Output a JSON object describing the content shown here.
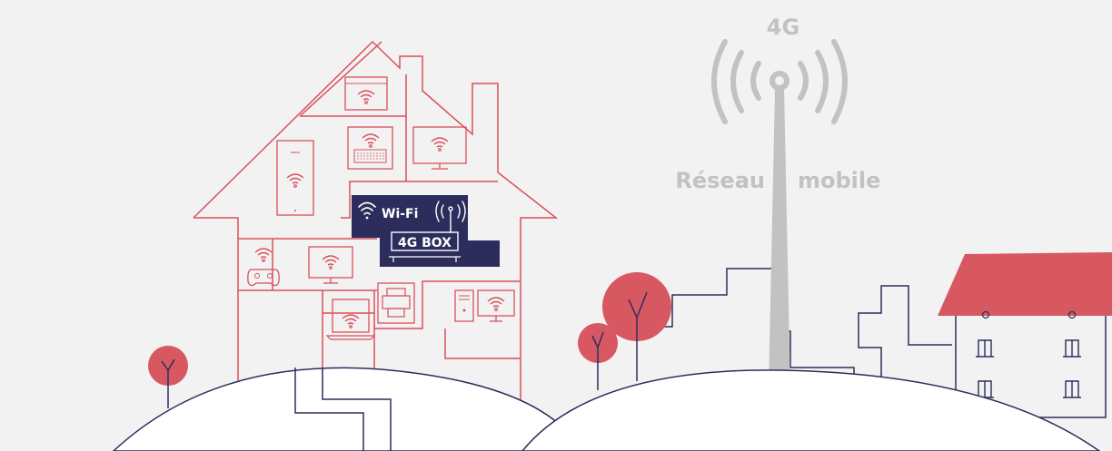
{
  "colors": {
    "background": "#f2f2f2",
    "house_line": "#d9505a",
    "tree_fill": "#d85862",
    "roof_fill": "#d85862",
    "navy": "#2c2d5c",
    "antenna_gray": "#c2c2c2",
    "hill_fill": "#ffffff"
  },
  "tower": {
    "label": "4G",
    "network_word_left": "Réseau",
    "network_word_right": "mobile"
  },
  "router": {
    "wifi_label": "Wi-Fi",
    "box_label": "4G BOX"
  },
  "icons": [
    "wifi-icon",
    "laptop-icon",
    "keyboard-icon",
    "monitor-icon",
    "tablet-icon",
    "gamepad-icon",
    "printer-icon",
    "computer-tower-icon",
    "antenna-signal-icon"
  ]
}
